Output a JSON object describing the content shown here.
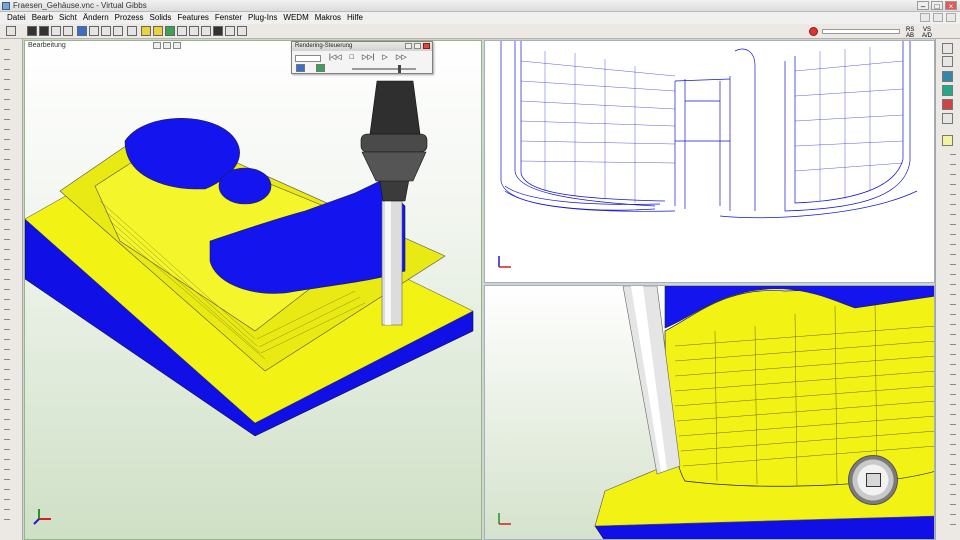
{
  "window": {
    "title": "Fraesen_Gehäuse.vnc - Virtual Gibbs",
    "buttons": [
      "–",
      "□",
      "×"
    ]
  },
  "menubar": {
    "items": [
      "Datei",
      "Bearb",
      "Sicht",
      "Ändern",
      "Prozess",
      "Solids",
      "Features",
      "Fenster",
      "Plug-Ins",
      "WEDM",
      "Makros",
      "Hilfe"
    ]
  },
  "toolbar": {
    "progress": 0.0,
    "status_a": "RS",
    "status_b": "VS",
    "status_c": "AB",
    "status_d": "A/D"
  },
  "viewports": {
    "left": {
      "label": "Bearbeitung"
    },
    "top_right": {
      "label": ""
    },
    "bottom_right": {
      "label": ""
    }
  },
  "render_control": {
    "title": "Rendering-Steuerung",
    "buttons": [
      "|◁◁",
      "□",
      "▷▷|",
      "▷",
      "▷▷"
    ]
  },
  "colors": {
    "part_yellow": "#f2f215",
    "part_blue": "#1010e6",
    "wire_blue": "#1515d4",
    "tool_gray": "#555555"
  }
}
